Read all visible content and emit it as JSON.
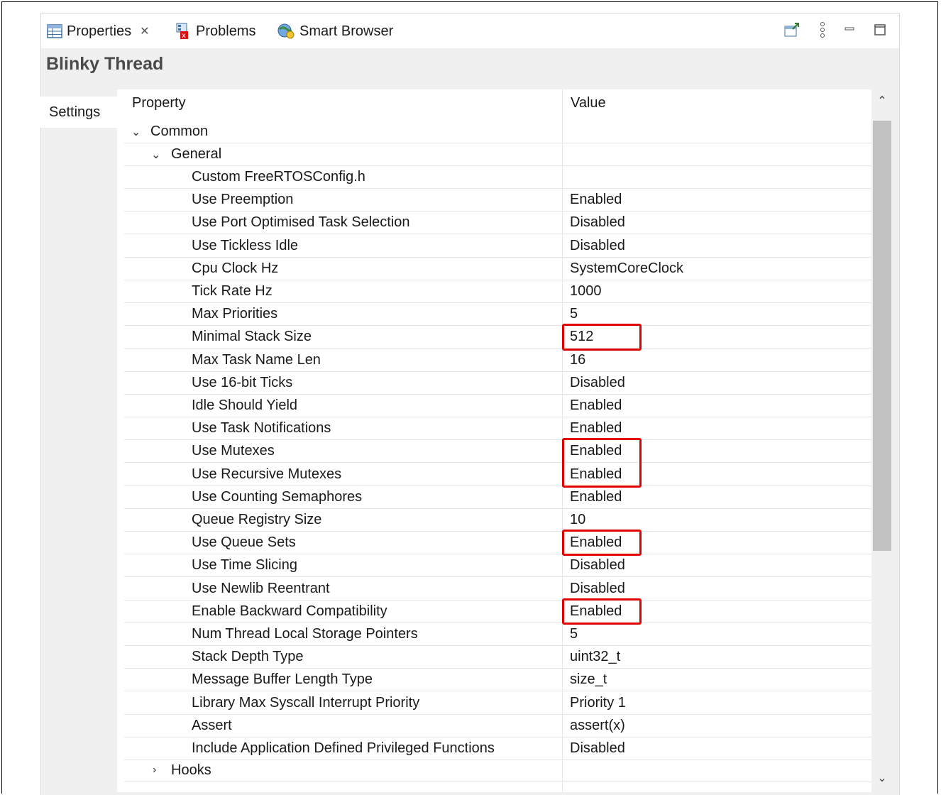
{
  "tabs": [
    {
      "label": "Properties",
      "icon": "properties-icon",
      "closable": true
    },
    {
      "label": "Problems",
      "icon": "problems-icon"
    },
    {
      "label": "Smart Browser",
      "icon": "smart-browser-icon"
    }
  ],
  "panel_title": "Blinky Thread",
  "side_tab": "Settings",
  "columns": {
    "property": "Property",
    "value": "Value"
  },
  "groups": {
    "common": "Common",
    "general": "General",
    "hooks": "Hooks"
  },
  "rows": [
    {
      "property": "Custom FreeRTOSConfig.h",
      "value": ""
    },
    {
      "property": "Use Preemption",
      "value": "Enabled"
    },
    {
      "property": "Use Port Optimised Task Selection",
      "value": "Disabled"
    },
    {
      "property": "Use Tickless Idle",
      "value": "Disabled"
    },
    {
      "property": "Cpu Clock Hz",
      "value": "SystemCoreClock"
    },
    {
      "property": "Tick Rate Hz",
      "value": "1000"
    },
    {
      "property": "Max Priorities",
      "value": "5"
    },
    {
      "property": "Minimal Stack Size",
      "value": "512",
      "highlighted": true
    },
    {
      "property": "Max Task Name Len",
      "value": "16"
    },
    {
      "property": "Use 16-bit Ticks",
      "value": "Disabled"
    },
    {
      "property": "Idle Should Yield",
      "value": "Enabled"
    },
    {
      "property": "Use Task Notifications",
      "value": "Enabled"
    },
    {
      "property": "Use Mutexes",
      "value": "Enabled",
      "highlighted": true
    },
    {
      "property": "Use Recursive Mutexes",
      "value": "Enabled",
      "highlighted": true
    },
    {
      "property": "Use Counting Semaphores",
      "value": "Enabled"
    },
    {
      "property": "Queue Registry Size",
      "value": "10"
    },
    {
      "property": "Use Queue Sets",
      "value": "Enabled",
      "highlighted": true
    },
    {
      "property": "Use Time Slicing",
      "value": "Disabled"
    },
    {
      "property": "Use Newlib Reentrant",
      "value": "Disabled"
    },
    {
      "property": "Enable Backward Compatibility",
      "value": "Enabled",
      "highlighted": true
    },
    {
      "property": "Num Thread Local Storage Pointers",
      "value": "5"
    },
    {
      "property": "Stack Depth Type",
      "value": "uint32_t"
    },
    {
      "property": "Message Buffer Length Type",
      "value": "size_t"
    },
    {
      "property": "Library Max Syscall Interrupt Priority",
      "value": "Priority 1"
    },
    {
      "property": "Assert",
      "value": "assert(x)"
    },
    {
      "property": "Include Application Defined Privileged Functions",
      "value": "Disabled"
    }
  ],
  "colors": {
    "highlight": "#e00000",
    "header_bg": "#f0f0f0"
  }
}
